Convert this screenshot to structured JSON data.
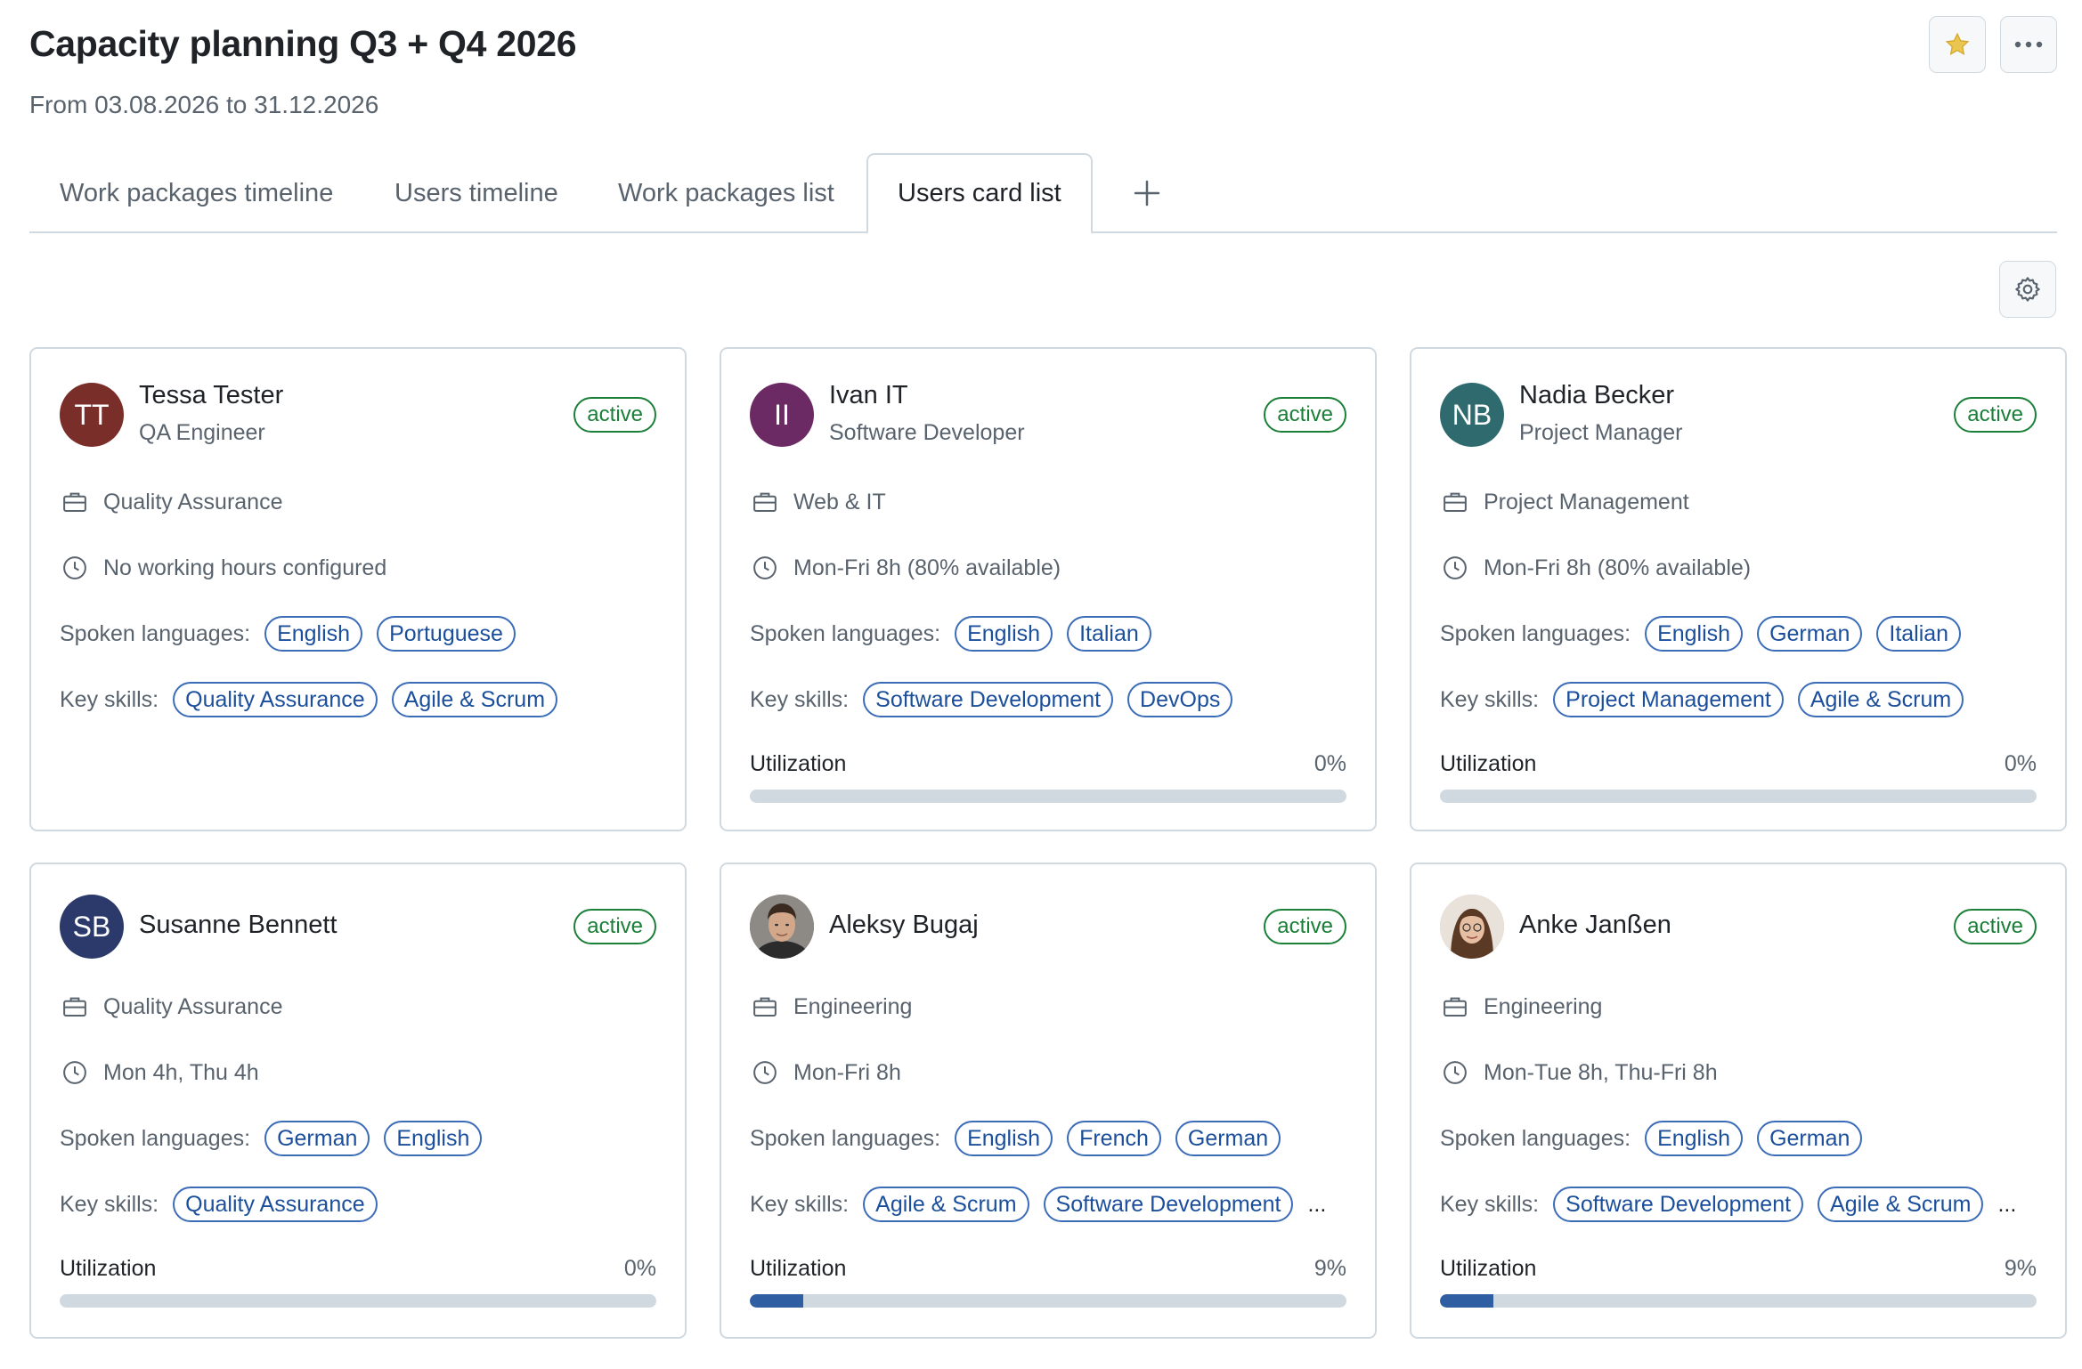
{
  "header": {
    "title": "Capacity planning Q3 + Q4 2026",
    "subtitle": "From 03.08.2026 to 31.12.2026"
  },
  "icons": {
    "favorite": "star-icon",
    "more": "kebab-horizontal-icon",
    "add_tab": "plus-icon",
    "settings": "gear-icon",
    "department": "briefcase-icon",
    "working_hours": "clock-icon"
  },
  "colors": {
    "status_green": "#1a7f37",
    "tag_blue": "#3b6cb8",
    "progress_fill": "#2f5ea3",
    "star": "#eac54f"
  },
  "tabs": [
    {
      "label": "Work packages timeline",
      "active": false
    },
    {
      "label": "Users timeline",
      "active": false
    },
    {
      "label": "Work packages list",
      "active": false
    },
    {
      "label": "Users card list",
      "active": true
    }
  ],
  "labels": {
    "spoken_languages": "Spoken languages:",
    "key_skills": "Key skills:",
    "utilization": "Utilization",
    "more_indicator": "..."
  },
  "users": [
    {
      "initials": "TT",
      "avatar_color": "#7a2e2a",
      "avatar_type": "initials",
      "name": "Tessa Tester",
      "role": "QA Engineer",
      "status": "active",
      "department": "Quality Assurance",
      "hours": "No working hours configured",
      "languages": [
        "English",
        "Portuguese"
      ],
      "skills": [
        "Quality Assurance",
        "Agile & Scrum"
      ],
      "skills_truncated": false,
      "utilization": null
    },
    {
      "initials": "II",
      "avatar_color": "#6b2a63",
      "avatar_type": "initials",
      "name": "Ivan IT",
      "role": "Software Developer",
      "status": "active",
      "department": "Web & IT",
      "hours": "Mon-Fri 8h (80% available)",
      "languages": [
        "English",
        "Italian"
      ],
      "skills": [
        "Software Development",
        "DevOps"
      ],
      "skills_truncated": false,
      "utilization": {
        "label": "0%",
        "fraction": 0
      }
    },
    {
      "initials": "NB",
      "avatar_color": "#2f6b6e",
      "avatar_type": "initials",
      "name": "Nadia Becker",
      "role": "Project Manager",
      "status": "active",
      "department": "Project Management",
      "hours": "Mon-Fri 8h (80% available)",
      "languages": [
        "English",
        "German",
        "Italian"
      ],
      "skills": [
        "Project Management",
        "Agile & Scrum"
      ],
      "skills_truncated": false,
      "utilization": {
        "label": "0%",
        "fraction": 0
      }
    },
    {
      "initials": "SB",
      "avatar_color": "#2b3a6b",
      "avatar_type": "initials",
      "name": "Susanne Bennett",
      "role": "",
      "status": "active",
      "department": "Quality Assurance",
      "hours": "Mon 4h, Thu 4h",
      "languages": [
        "German",
        "English"
      ],
      "skills": [
        "Quality Assurance"
      ],
      "skills_truncated": false,
      "utilization": {
        "label": "0%",
        "fraction": 0
      }
    },
    {
      "initials": "",
      "avatar_color": "#6b5a4e",
      "avatar_type": "photo-man",
      "name": "Aleksy Bugaj",
      "role": "",
      "status": "active",
      "department": "Engineering",
      "hours": "Mon-Fri 8h",
      "languages": [
        "English",
        "French",
        "German"
      ],
      "skills": [
        "Agile & Scrum",
        "Software Development"
      ],
      "skills_truncated": true,
      "utilization": {
        "label": "9%",
        "fraction": 0.09
      }
    },
    {
      "initials": "",
      "avatar_color": "#c9a58a",
      "avatar_type": "photo-woman",
      "name": "Anke Janßen",
      "role": "",
      "status": "active",
      "department": "Engineering",
      "hours": "Mon-Tue 8h, Thu-Fri 8h",
      "languages": [
        "English",
        "German"
      ],
      "skills": [
        "Software Development",
        "Agile & Scrum"
      ],
      "skills_truncated": true,
      "utilization": {
        "label": "9%",
        "fraction": 0.09
      }
    }
  ]
}
